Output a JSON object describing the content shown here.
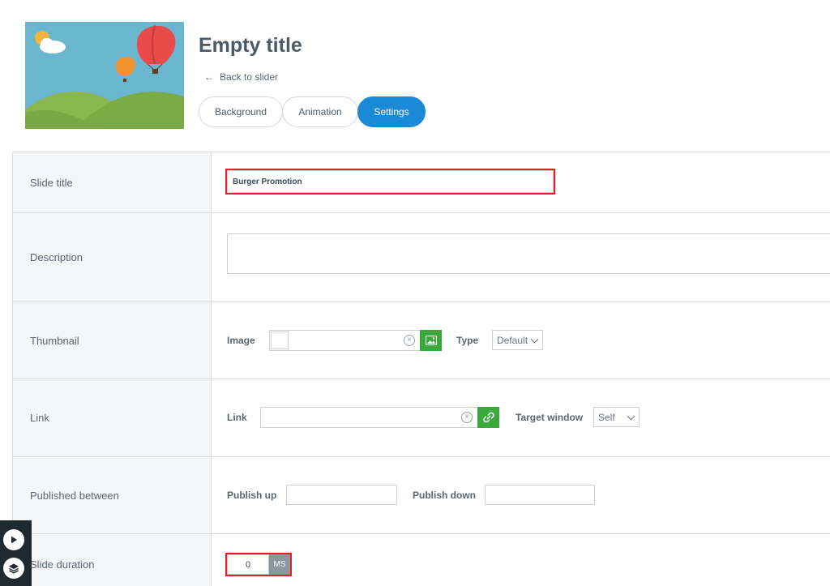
{
  "header": {
    "title": "Empty title",
    "back_label": "Back to slider",
    "tabs": [
      {
        "label": "Background",
        "active": false
      },
      {
        "label": "Animation",
        "active": false
      },
      {
        "label": "Settings",
        "active": true
      }
    ]
  },
  "form": {
    "slide_title": {
      "label": "Slide title",
      "value": "Burger Promotion"
    },
    "description": {
      "label": "Description",
      "value": ""
    },
    "thumbnail": {
      "label": "Thumbnail",
      "image_label": "Image",
      "type_label": "Type",
      "type_value": "Default"
    },
    "link": {
      "label": "Link",
      "link_label": "Link",
      "target_label": "Target window",
      "target_value": "Self"
    },
    "published": {
      "label": "Published between",
      "up_label": "Publish up",
      "down_label": "Publish down"
    },
    "duration": {
      "label": "Slide duration",
      "value": "0",
      "unit": "MS"
    }
  },
  "colors": {
    "accent": "#1b8ad6",
    "green": "#3aa83a",
    "highlight": "#e32227"
  },
  "icons": [
    "sun-cloud-icon",
    "balloon-icon",
    "arrow-left-icon",
    "clear-circle-icon",
    "image-icon",
    "link-chain-icon",
    "play-icon",
    "layers-icon"
  ]
}
